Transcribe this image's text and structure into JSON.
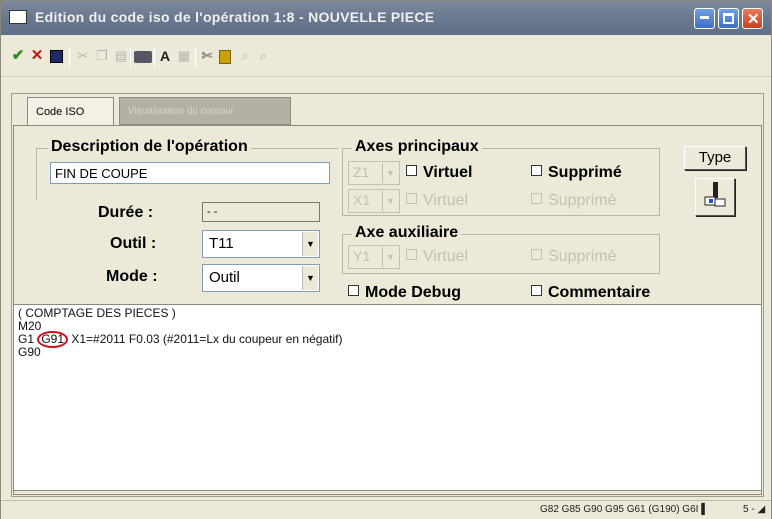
{
  "window": {
    "title": "Edition du code iso de l'opération 1:8 - NOUVELLE PIECE"
  },
  "toolbar": {
    "icons": [
      "checkmark-icon",
      "cancel-icon",
      "save-icon",
      "cut-icon",
      "copy-icon",
      "paste-icon",
      "print-icon",
      "font-icon",
      "grid-icon",
      "tools-icon",
      "flag-icon",
      "search-icon",
      "search-next-icon"
    ],
    "font_label": "A"
  },
  "tabs": [
    {
      "label": "Code ISO",
      "active": true
    },
    {
      "label": "Visualisation du contour",
      "active": false
    }
  ],
  "description": {
    "legend": "Description de l'opération",
    "value": "FIN DE COUPE"
  },
  "duree": {
    "label": "Durée :",
    "value": "- -"
  },
  "outil": {
    "label": "Outil :",
    "value": "T11"
  },
  "mode": {
    "label": "Mode :",
    "value": "Outil"
  },
  "axes_principaux": {
    "legend": "Axes principaux",
    "rows": [
      {
        "axis": "Z1",
        "virtuel": "Virtuel",
        "supprime": "Supprimé",
        "enabled": true
      },
      {
        "axis": "X1",
        "virtuel": "Virtuel",
        "supprime": "Supprimé",
        "enabled": false
      }
    ]
  },
  "axe_auxiliaire": {
    "legend": "Axe auxiliaire",
    "axis": "Y1",
    "virtuel": "Virtuel",
    "supprime": "Supprimé"
  },
  "mode_debug": "Mode Debug",
  "commentaire": "Commentaire",
  "type_button": "Type",
  "code": {
    "line1": "( COMPTAGE DES PIECES )",
    "line2": "M20",
    "line3_prefix": "G1 ",
    "line3_circled": "G91",
    "line3_suffix": " X1=#2011 F0.03 (#2011=Lx du coupeur en négatif)",
    "line4": "G90"
  },
  "status": {
    "codes": "G82 G85 G90 G95 G61 (G190) G6I ▌",
    "page": "5 -  ◢"
  },
  "colors": {
    "titlebar": "#6b7a90",
    "accent_circle": "#d01020",
    "check": "#2e8b1e",
    "cancel": "#c0180c"
  }
}
